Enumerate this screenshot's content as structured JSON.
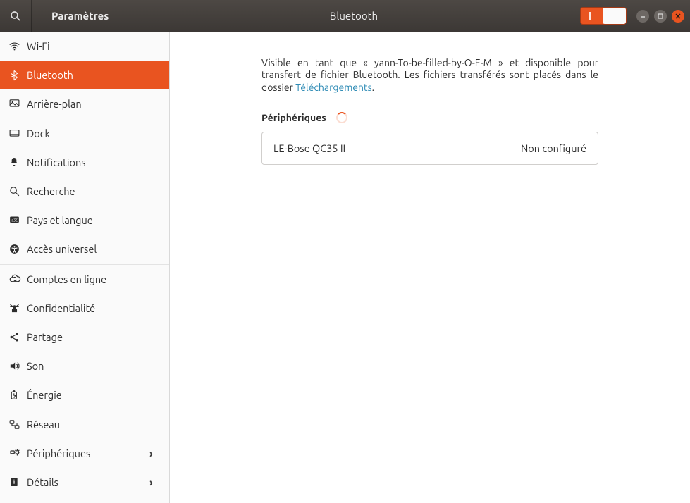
{
  "header": {
    "app_title": "Paramètres",
    "page_title": "Bluetooth",
    "toggle_on": true
  },
  "sidebar": {
    "items": [
      {
        "key": "wifi",
        "label": "Wi-Fi",
        "icon": "wifi",
        "chevron": false
      },
      {
        "key": "bluetooth",
        "label": "Bluetooth",
        "icon": "bluetooth",
        "chevron": false,
        "active": true
      },
      {
        "key": "arriere-plan",
        "label": "Arrière-plan",
        "icon": "background",
        "chevron": false
      },
      {
        "key": "dock",
        "label": "Dock",
        "icon": "dock",
        "chevron": false
      },
      {
        "key": "notifications",
        "label": "Notifications",
        "icon": "bell",
        "chevron": false
      },
      {
        "key": "recherche",
        "label": "Recherche",
        "icon": "search",
        "chevron": false
      },
      {
        "key": "pays-langue",
        "label": "Pays et langue",
        "icon": "language",
        "chevron": false
      },
      {
        "key": "acces-universel",
        "label": "Accès universel",
        "icon": "accessibility",
        "chevron": false,
        "sep_after": true
      },
      {
        "key": "comptes",
        "label": "Comptes en ligne",
        "icon": "cloud-sync",
        "chevron": false
      },
      {
        "key": "confidentialite",
        "label": "Confidentialité",
        "icon": "privacy",
        "chevron": false
      },
      {
        "key": "partage",
        "label": "Partage",
        "icon": "share",
        "chevron": false
      },
      {
        "key": "son",
        "label": "Son",
        "icon": "sound",
        "chevron": false
      },
      {
        "key": "energie",
        "label": "Énergie",
        "icon": "power",
        "chevron": false
      },
      {
        "key": "reseau",
        "label": "Réseau",
        "icon": "network",
        "chevron": false
      },
      {
        "key": "peripheriques",
        "label": "Périphériques",
        "icon": "devices",
        "chevron": true
      },
      {
        "key": "details",
        "label": "Détails",
        "icon": "details",
        "chevron": true
      }
    ]
  },
  "content": {
    "description_prefix": "Visible en tant que « yann-To-be-filled-by-O-E-M » et disponible pour transfert de fichier Bluetooth. Les fichiers transférés sont placés dans le dossier ",
    "downloads_link": "Téléchargements",
    "description_suffix": ".",
    "devices_label": "Périphériques",
    "devices": [
      {
        "name": "LE-Bose QC35 II",
        "status": "Non configuré"
      }
    ]
  }
}
